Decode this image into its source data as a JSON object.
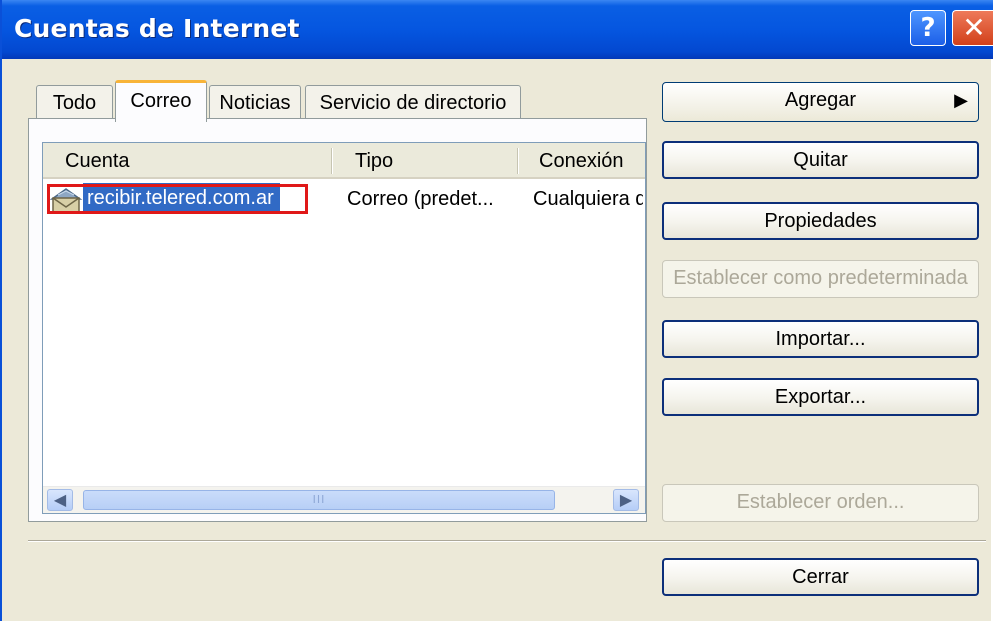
{
  "window": {
    "title": "Cuentas de Internet",
    "help_label": "?",
    "close_label": "✕"
  },
  "tabs": [
    {
      "label": "Todo"
    },
    {
      "label": "Correo",
      "selected": true
    },
    {
      "label": "Noticias"
    },
    {
      "label": "Servicio de directorio"
    }
  ],
  "list": {
    "columns": [
      "Cuenta",
      "Tipo",
      "Conexión"
    ],
    "rows": [
      {
        "cuenta": "recibir.telered.com.ar",
        "tipo": "Correo (predet...",
        "conexion": "Cualquiera d",
        "selected": true
      }
    ],
    "scroll_thumb_grip": "III"
  },
  "buttons": {
    "agregar": "Agregar",
    "quitar": "Quitar",
    "propiedades": "Propiedades",
    "establecer_predeterminada": "Establecer como predeterminada",
    "importar": "Importar...",
    "exportar": "Exportar...",
    "establecer_orden": "Establecer orden...",
    "cerrar": "Cerrar"
  },
  "colors": {
    "title_bar": "#0556e0",
    "selection": "#316ac5",
    "highlight_box": "#e01818",
    "active_tab_accent": "#f8b438"
  }
}
